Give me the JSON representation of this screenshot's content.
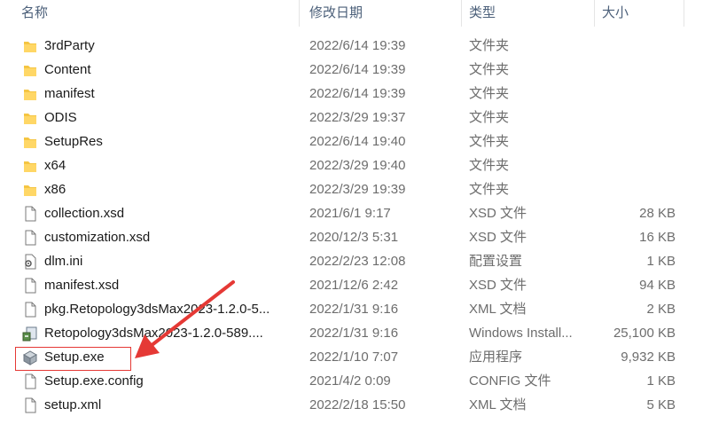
{
  "columns": {
    "name": "名称",
    "date": "修改日期",
    "type": "类型",
    "size": "大小"
  },
  "files": [
    {
      "name": "3rdParty",
      "date": "2022/6/14 19:39",
      "type": "文件夹",
      "size": "",
      "icon": "folder-icon"
    },
    {
      "name": "Content",
      "date": "2022/6/14 19:39",
      "type": "文件夹",
      "size": "",
      "icon": "folder-icon"
    },
    {
      "name": "manifest",
      "date": "2022/6/14 19:39",
      "type": "文件夹",
      "size": "",
      "icon": "folder-icon"
    },
    {
      "name": "ODIS",
      "date": "2022/3/29 19:37",
      "type": "文件夹",
      "size": "",
      "icon": "folder-icon"
    },
    {
      "name": "SetupRes",
      "date": "2022/6/14 19:40",
      "type": "文件夹",
      "size": "",
      "icon": "folder-icon"
    },
    {
      "name": "x64",
      "date": "2022/3/29 19:40",
      "type": "文件夹",
      "size": "",
      "icon": "folder-icon"
    },
    {
      "name": "x86",
      "date": "2022/3/29 19:39",
      "type": "文件夹",
      "size": "",
      "icon": "folder-icon"
    },
    {
      "name": "collection.xsd",
      "date": "2021/6/1 9:17",
      "type": "XSD 文件",
      "size": "28 KB",
      "icon": "file-icon"
    },
    {
      "name": "customization.xsd",
      "date": "2020/12/3 5:31",
      "type": "XSD 文件",
      "size": "16 KB",
      "icon": "file-icon"
    },
    {
      "name": "dlm.ini",
      "date": "2022/2/23 12:08",
      "type": "配置设置",
      "size": "1 KB",
      "icon": "settings-file-icon"
    },
    {
      "name": "manifest.xsd",
      "date": "2021/12/6 2:42",
      "type": "XSD 文件",
      "size": "94 KB",
      "icon": "file-icon"
    },
    {
      "name": "pkg.Retopology3dsMax2023-1.2.0-5...",
      "date": "2022/1/31 9:16",
      "type": "XML 文档",
      "size": "2 KB",
      "icon": "file-icon"
    },
    {
      "name": "Retopology3dsMax2023-1.2.0-589....",
      "date": "2022/1/31 9:16",
      "type": "Windows Install...",
      "size": "25,100 KB",
      "icon": "installer-icon"
    },
    {
      "name": "Setup.exe",
      "date": "2022/1/10 7:07",
      "type": "应用程序",
      "size": "9,932 KB",
      "icon": "setup-app-icon"
    },
    {
      "name": "Setup.exe.config",
      "date": "2021/4/2 0:09",
      "type": "CONFIG 文件",
      "size": "1 KB",
      "icon": "file-icon"
    },
    {
      "name": "setup.xml",
      "date": "2022/2/18 15:50",
      "type": "XML 文档",
      "size": "5 KB",
      "icon": "file-icon"
    }
  ],
  "colors": {
    "folder": "#f5c542",
    "header_text": "#4c607a",
    "annotation": "#e53935"
  }
}
